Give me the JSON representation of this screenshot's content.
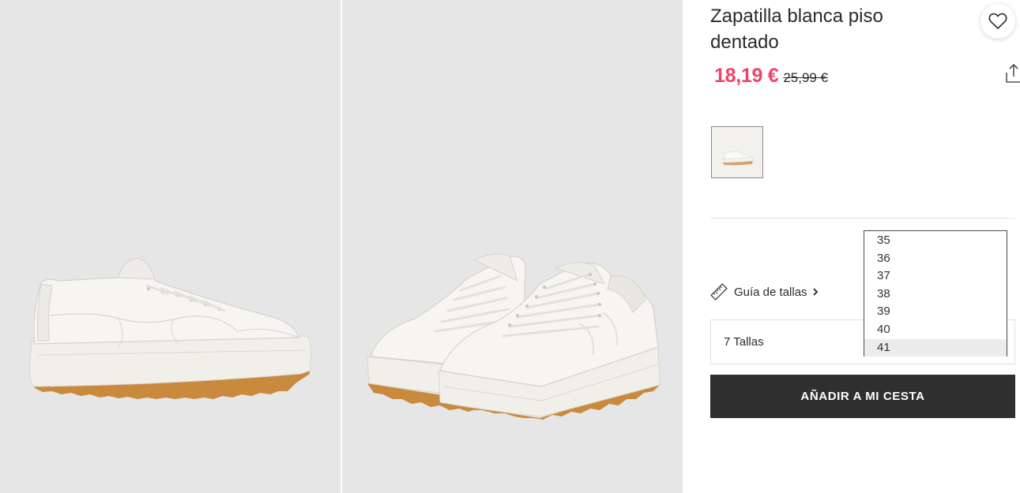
{
  "product": {
    "title": "Zapatilla blanca piso dentado",
    "price_current": "18,19 €",
    "price_old": "25,99 €"
  },
  "size_guide": {
    "label": "Guía de tallas"
  },
  "size_select": {
    "value": "7 Tallas",
    "options": [
      "35",
      "36",
      "37",
      "38",
      "39",
      "40",
      "41"
    ],
    "highlighted": "41"
  },
  "cart": {
    "button_label": "AÑADIR A MI CESTA"
  },
  "colors": {
    "sale_price": "#f0436a",
    "button_bg": "#2f2f2f",
    "photo_bg": "#e6e6e6",
    "sole": "#c98a3e"
  },
  "icons": [
    "heart-icon",
    "share-icon",
    "ruler-icon",
    "chevron-right-icon"
  ]
}
